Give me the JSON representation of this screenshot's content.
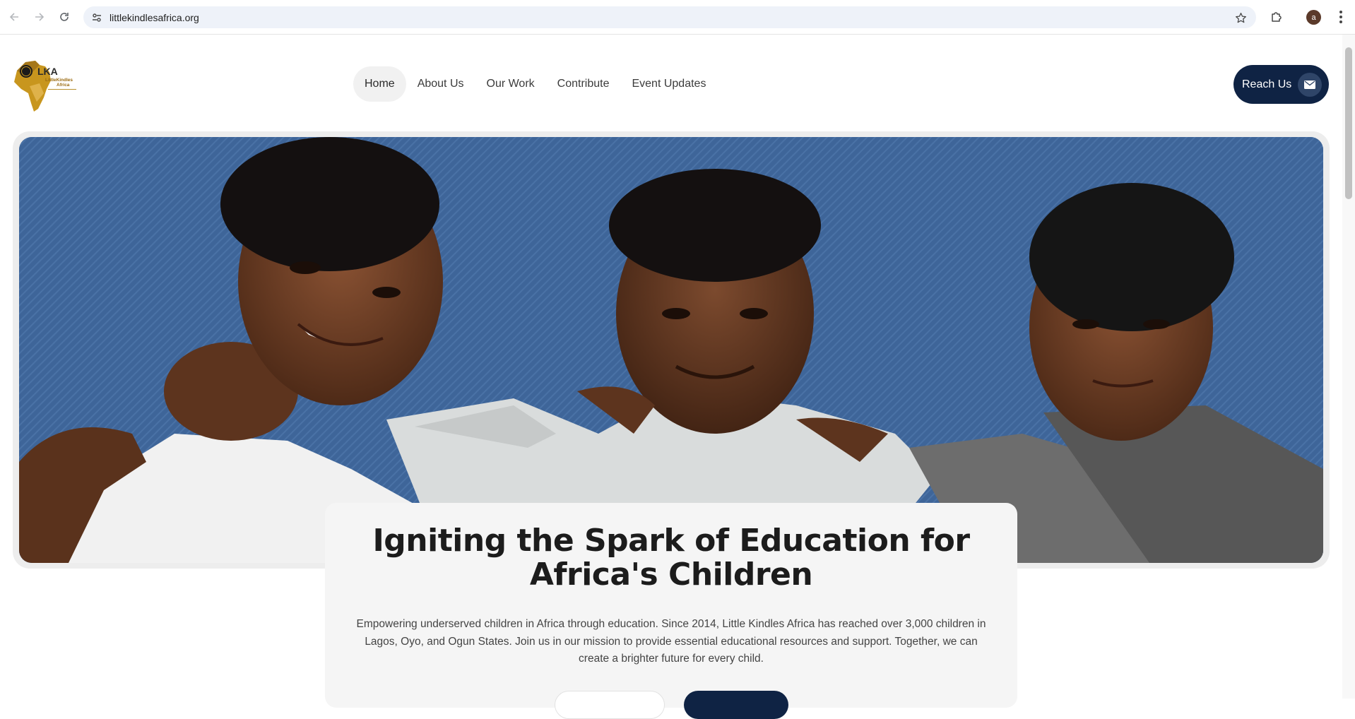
{
  "browser": {
    "url": "littlekindlesafrica.org",
    "profile_initial": "a"
  },
  "site": {
    "logo": {
      "alt": "Little Kindles Africa logo",
      "abbreviation": "LKA",
      "name_line1": "LittleKindles",
      "name_line2": "Africa"
    },
    "nav": {
      "items": [
        {
          "label": "Home",
          "active": true
        },
        {
          "label": "About Us",
          "active": false
        },
        {
          "label": "Our Work",
          "active": false
        },
        {
          "label": "Contribute",
          "active": false
        },
        {
          "label": "Event Updates",
          "active": false
        }
      ]
    },
    "cta": {
      "label": "Reach Us",
      "icon": "envelope-icon"
    }
  },
  "hero": {
    "image_description": "Three smiling children with arms around each other against a blue textured background",
    "title": "Igniting the Spark of Education for Africa's Children",
    "description": "Empowering underserved children in Africa through education. Since 2014, Little Kindles Africa has reached over 3,000 children in Lagos, Oyo, and Ogun States. Join us in our mission to provide essential educational resources and support. Together, we can create a brighter future for every child."
  },
  "colors": {
    "brand_navy": "#0f2344",
    "hero_blue": "#3e6599",
    "logo_gold": "#c8961e"
  }
}
